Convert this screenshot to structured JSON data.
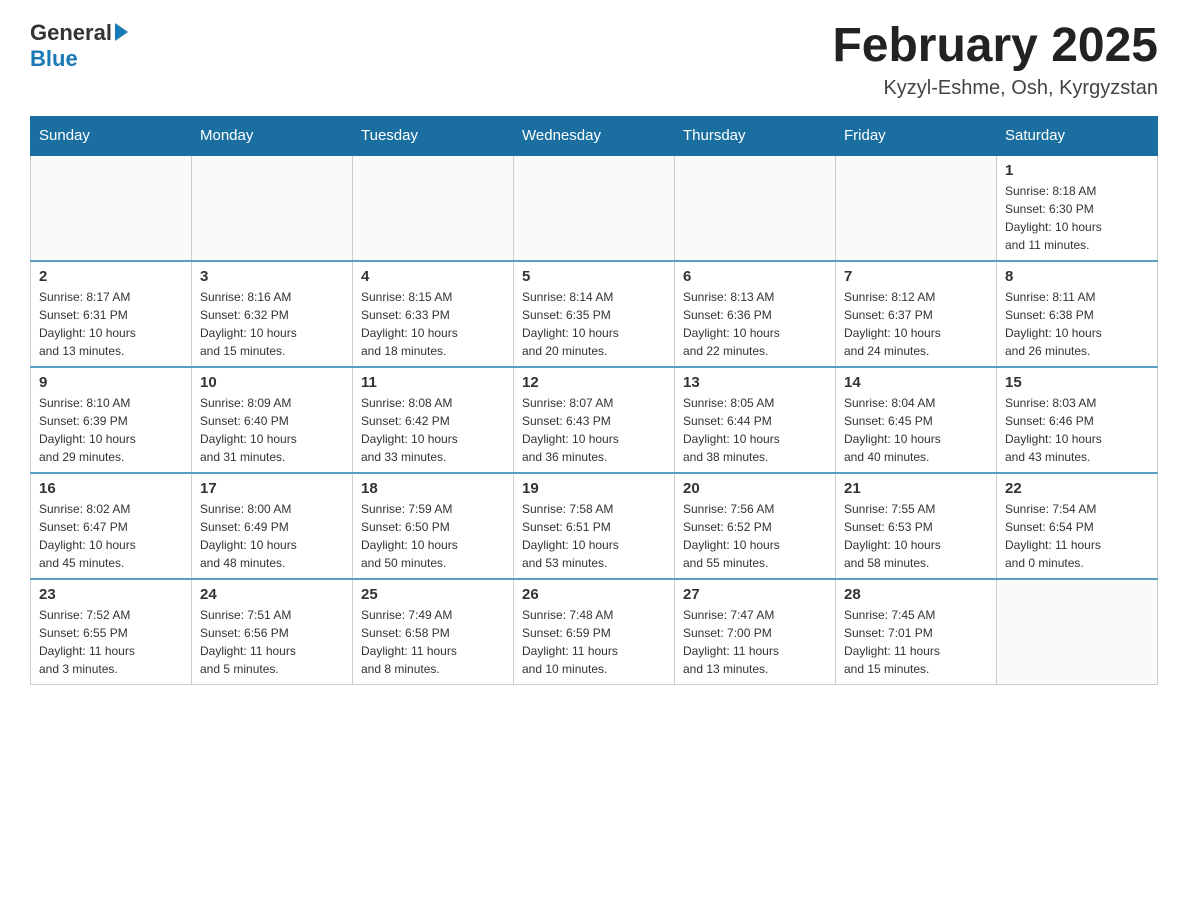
{
  "header": {
    "logo_general": "General",
    "logo_blue": "Blue",
    "month_title": "February 2025",
    "location": "Kyzyl-Eshme, Osh, Kyrgyzstan"
  },
  "weekdays": [
    "Sunday",
    "Monday",
    "Tuesday",
    "Wednesday",
    "Thursday",
    "Friday",
    "Saturday"
  ],
  "weeks": [
    [
      {
        "day": "",
        "info": ""
      },
      {
        "day": "",
        "info": ""
      },
      {
        "day": "",
        "info": ""
      },
      {
        "day": "",
        "info": ""
      },
      {
        "day": "",
        "info": ""
      },
      {
        "day": "",
        "info": ""
      },
      {
        "day": "1",
        "info": "Sunrise: 8:18 AM\nSunset: 6:30 PM\nDaylight: 10 hours\nand 11 minutes."
      }
    ],
    [
      {
        "day": "2",
        "info": "Sunrise: 8:17 AM\nSunset: 6:31 PM\nDaylight: 10 hours\nand 13 minutes."
      },
      {
        "day": "3",
        "info": "Sunrise: 8:16 AM\nSunset: 6:32 PM\nDaylight: 10 hours\nand 15 minutes."
      },
      {
        "day": "4",
        "info": "Sunrise: 8:15 AM\nSunset: 6:33 PM\nDaylight: 10 hours\nand 18 minutes."
      },
      {
        "day": "5",
        "info": "Sunrise: 8:14 AM\nSunset: 6:35 PM\nDaylight: 10 hours\nand 20 minutes."
      },
      {
        "day": "6",
        "info": "Sunrise: 8:13 AM\nSunset: 6:36 PM\nDaylight: 10 hours\nand 22 minutes."
      },
      {
        "day": "7",
        "info": "Sunrise: 8:12 AM\nSunset: 6:37 PM\nDaylight: 10 hours\nand 24 minutes."
      },
      {
        "day": "8",
        "info": "Sunrise: 8:11 AM\nSunset: 6:38 PM\nDaylight: 10 hours\nand 26 minutes."
      }
    ],
    [
      {
        "day": "9",
        "info": "Sunrise: 8:10 AM\nSunset: 6:39 PM\nDaylight: 10 hours\nand 29 minutes."
      },
      {
        "day": "10",
        "info": "Sunrise: 8:09 AM\nSunset: 6:40 PM\nDaylight: 10 hours\nand 31 minutes."
      },
      {
        "day": "11",
        "info": "Sunrise: 8:08 AM\nSunset: 6:42 PM\nDaylight: 10 hours\nand 33 minutes."
      },
      {
        "day": "12",
        "info": "Sunrise: 8:07 AM\nSunset: 6:43 PM\nDaylight: 10 hours\nand 36 minutes."
      },
      {
        "day": "13",
        "info": "Sunrise: 8:05 AM\nSunset: 6:44 PM\nDaylight: 10 hours\nand 38 minutes."
      },
      {
        "day": "14",
        "info": "Sunrise: 8:04 AM\nSunset: 6:45 PM\nDaylight: 10 hours\nand 40 minutes."
      },
      {
        "day": "15",
        "info": "Sunrise: 8:03 AM\nSunset: 6:46 PM\nDaylight: 10 hours\nand 43 minutes."
      }
    ],
    [
      {
        "day": "16",
        "info": "Sunrise: 8:02 AM\nSunset: 6:47 PM\nDaylight: 10 hours\nand 45 minutes."
      },
      {
        "day": "17",
        "info": "Sunrise: 8:00 AM\nSunset: 6:49 PM\nDaylight: 10 hours\nand 48 minutes."
      },
      {
        "day": "18",
        "info": "Sunrise: 7:59 AM\nSunset: 6:50 PM\nDaylight: 10 hours\nand 50 minutes."
      },
      {
        "day": "19",
        "info": "Sunrise: 7:58 AM\nSunset: 6:51 PM\nDaylight: 10 hours\nand 53 minutes."
      },
      {
        "day": "20",
        "info": "Sunrise: 7:56 AM\nSunset: 6:52 PM\nDaylight: 10 hours\nand 55 minutes."
      },
      {
        "day": "21",
        "info": "Sunrise: 7:55 AM\nSunset: 6:53 PM\nDaylight: 10 hours\nand 58 minutes."
      },
      {
        "day": "22",
        "info": "Sunrise: 7:54 AM\nSunset: 6:54 PM\nDaylight: 11 hours\nand 0 minutes."
      }
    ],
    [
      {
        "day": "23",
        "info": "Sunrise: 7:52 AM\nSunset: 6:55 PM\nDaylight: 11 hours\nand 3 minutes."
      },
      {
        "day": "24",
        "info": "Sunrise: 7:51 AM\nSunset: 6:56 PM\nDaylight: 11 hours\nand 5 minutes."
      },
      {
        "day": "25",
        "info": "Sunrise: 7:49 AM\nSunset: 6:58 PM\nDaylight: 11 hours\nand 8 minutes."
      },
      {
        "day": "26",
        "info": "Sunrise: 7:48 AM\nSunset: 6:59 PM\nDaylight: 11 hours\nand 10 minutes."
      },
      {
        "day": "27",
        "info": "Sunrise: 7:47 AM\nSunset: 7:00 PM\nDaylight: 11 hours\nand 13 minutes."
      },
      {
        "day": "28",
        "info": "Sunrise: 7:45 AM\nSunset: 7:01 PM\nDaylight: 11 hours\nand 15 minutes."
      },
      {
        "day": "",
        "info": ""
      }
    ]
  ]
}
